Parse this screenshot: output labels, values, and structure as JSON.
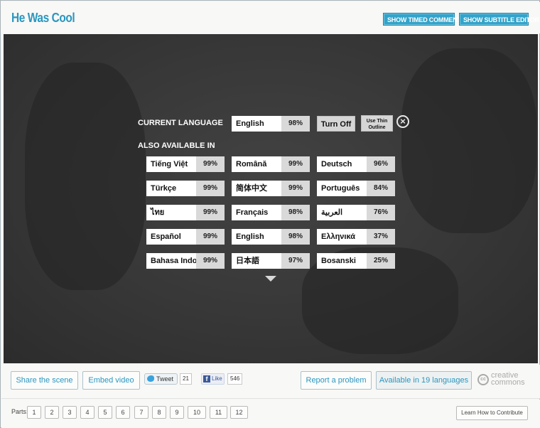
{
  "header": {
    "title": "He Was Cool",
    "show_timed_comments": "SHOW TIMED COMMENTS",
    "show_subtitle_editor": "SHOW SUBTITLE EDITOR"
  },
  "language_panel": {
    "current_label": "CURRENT LANGUAGE",
    "current": {
      "name": "English",
      "pct": "98%"
    },
    "turn_off": "Turn Off",
    "use_thin_outline_line1": "Use Thin",
    "use_thin_outline_line2": "Outline",
    "also_label": "ALSO AVAILABLE IN",
    "languages": [
      {
        "name": "Tiếng Việt",
        "pct": "99%"
      },
      {
        "name": "Română",
        "pct": "99%"
      },
      {
        "name": "Deutsch",
        "pct": "96%"
      },
      {
        "name": "Türkçe",
        "pct": "99%"
      },
      {
        "name": "简体中文",
        "pct": "99%"
      },
      {
        "name": "Português",
        "pct": "84%"
      },
      {
        "name": "ไทย",
        "pct": "99%"
      },
      {
        "name": "Français",
        "pct": "98%"
      },
      {
        "name": "العربية",
        "pct": "76%"
      },
      {
        "name": "Español",
        "pct": "99%"
      },
      {
        "name": "English",
        "pct": "98%"
      },
      {
        "name": "Ελληνικά",
        "pct": "37%"
      },
      {
        "name": "Bahasa Indonesia",
        "pct": "99%"
      },
      {
        "name": "日本語",
        "pct": "97%"
      },
      {
        "name": "Bosanski",
        "pct": "25%"
      }
    ]
  },
  "share_bar": {
    "share_scene": "Share the scene",
    "embed_video": "Embed video",
    "tweet": "Tweet",
    "tweet_count": "21",
    "like": "Like",
    "like_count": "546",
    "report_problem": "Report a problem",
    "available_languages": "Available in 19 languages",
    "cc_line1": "creative",
    "cc_line2": "commons",
    "cc_mark": "cc"
  },
  "footer": {
    "parts_label": "Parts:",
    "parts": [
      "1",
      "2",
      "3",
      "4",
      "5",
      "6",
      "7",
      "8",
      "9",
      "10",
      "11",
      "12"
    ],
    "learn_contribute": "Learn How to Contribute"
  },
  "colors": {
    "accent": "#2a97c0",
    "header_button": "#33a3c9",
    "video_bg": "#373737"
  }
}
